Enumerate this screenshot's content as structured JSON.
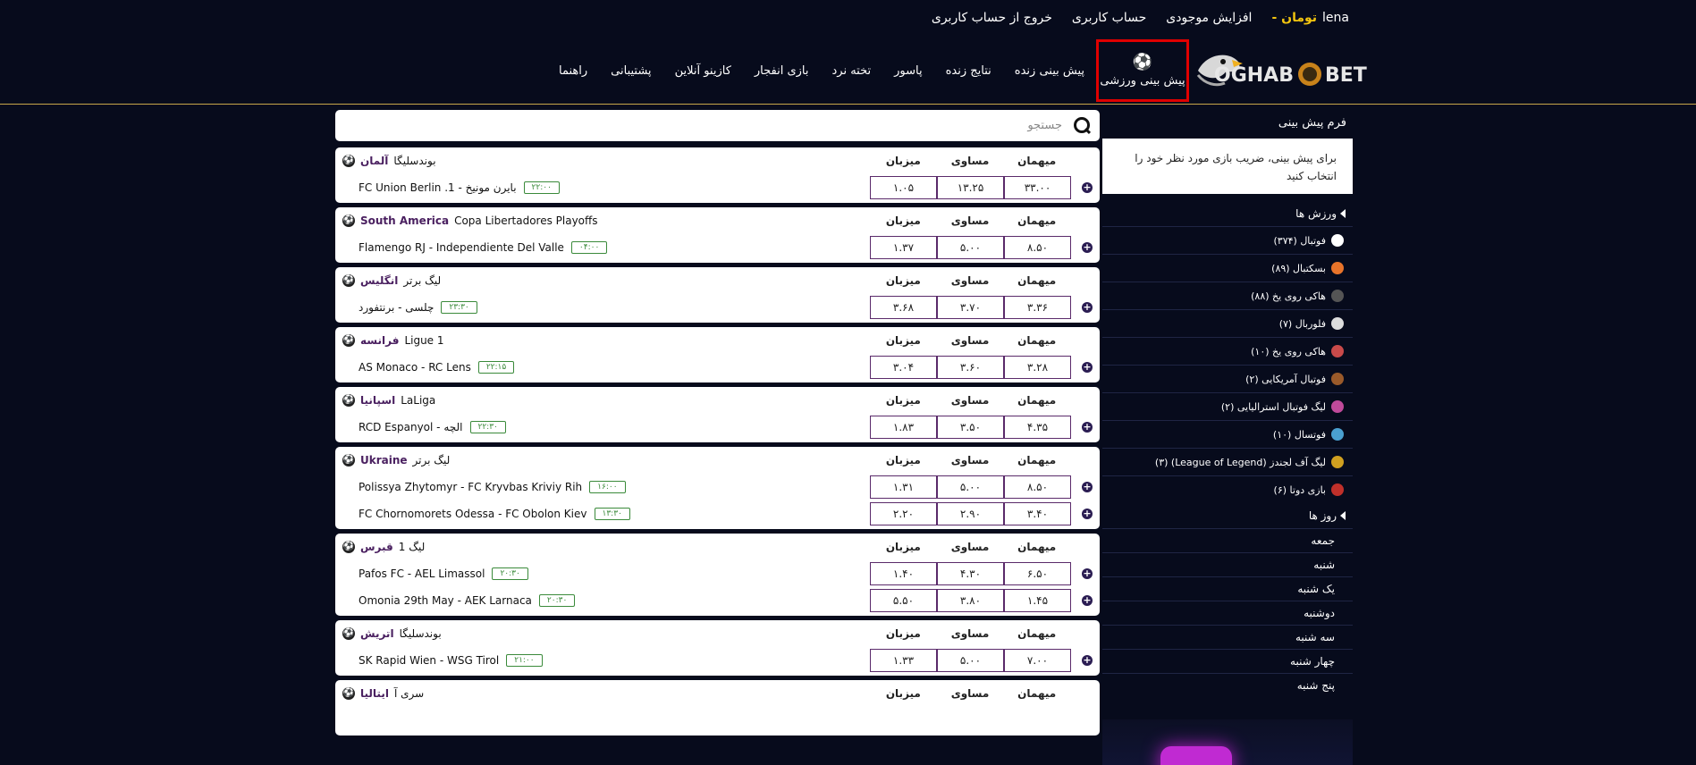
{
  "topbar": {
    "username": "lena",
    "currency": "تومان -",
    "deposit": "افزایش موجودی",
    "account": "حساب کاربری",
    "logout": "خروج از حساب کاربری"
  },
  "logo": {
    "text_left": "OGHAB",
    "text_right": "BET"
  },
  "nav": {
    "items": [
      "پیش بینی ورزشی",
      "پیش بینی زنده",
      "نتایج زنده",
      "پاسور",
      "تخته نرد",
      "بازی انفجار",
      "کازینو آنلاین",
      "پشتیبانی",
      "راهنما"
    ]
  },
  "search": {
    "placeholder": "جستجو"
  },
  "columns": {
    "away": "میهمان",
    "draw": "مساوی",
    "home": "میزبان"
  },
  "matches": [
    {
      "country": "آلمان",
      "league": "بوندسلیگا",
      "rows": [
        {
          "teams": "FC Union Berlin .1 - بایرن مونیخ",
          "time": "۲۲:۰۰",
          "away": "۳۳.۰۰",
          "draw": "۱۳.۲۵",
          "home": "۱.۰۵"
        }
      ]
    },
    {
      "country": "South America",
      "league": "Copa Libertadores Playoffs",
      "rows": [
        {
          "teams": "Flamengo RJ - Independiente Del Valle",
          "time": "۰۴:۰۰",
          "away": "۸.۵۰",
          "draw": "۵.۰۰",
          "home": "۱.۳۷"
        }
      ]
    },
    {
      "country": "انگلیس",
      "league": "لیگ برتر",
      "rows": [
        {
          "teams": "چلسی - برنتفورد",
          "time": "۲۳:۳۰",
          "away": "۳.۳۶",
          "draw": "۳.۷۰",
          "home": "۳.۶۸"
        }
      ]
    },
    {
      "country": "فرانسه",
      "league": "Ligue 1",
      "rows": [
        {
          "teams": "AS Monaco - RC Lens",
          "time": "۲۲:۱۵",
          "away": "۳.۲۸",
          "draw": "۳.۶۰",
          "home": "۳.۰۴"
        }
      ]
    },
    {
      "country": "اسپانیا",
      "league": "LaLiga",
      "rows": [
        {
          "teams": "RCD Espanyol - الچه",
          "time": "۲۲:۳۰",
          "away": "۴.۳۵",
          "draw": "۳.۵۰",
          "home": "۱.۸۳"
        }
      ]
    },
    {
      "country": "Ukraine",
      "league": "لیگ برتر",
      "rows": [
        {
          "teams": "Polissya Zhytomyr - FC Kryvbas Kriviy Rih",
          "time": "۱۶:۰۰",
          "away": "۸.۵۰",
          "draw": "۵.۰۰",
          "home": "۱.۳۱"
        },
        {
          "teams": "FC Chornomorets Odessa - FC Obolon Kiev",
          "time": "۱۳:۳۰",
          "away": "۳.۴۰",
          "draw": "۲.۹۰",
          "home": "۲.۲۰"
        }
      ]
    },
    {
      "country": "قبرس",
      "league": "لیگ 1",
      "rows": [
        {
          "teams": "Pafos FC - AEL Limassol",
          "time": "۲۰:۳۰",
          "away": "۶.۵۰",
          "draw": "۴.۳۰",
          "home": "۱.۴۰"
        },
        {
          "teams": "Omonia 29th May - AEK Larnaca",
          "time": "۲۰:۳۰",
          "away": "۱.۴۵",
          "draw": "۳.۸۰",
          "home": "۵.۵۰"
        }
      ]
    },
    {
      "country": "اتریش",
      "league": "بوندسلیگا",
      "rows": [
        {
          "teams": "SK Rapid Wien - WSG Tirol",
          "time": "۲۱:۰۰",
          "away": "۷.۰۰",
          "draw": "۵.۰۰",
          "home": "۱.۳۳"
        }
      ]
    },
    {
      "country": "ایتالیا",
      "league": "سری آ",
      "rows": []
    }
  ],
  "sidebar": {
    "slip_title": "فرم پیش بینی",
    "slip_text": "برای پیش بینی، ضریب بازی مورد نظر خود را انتخاب کنید",
    "sports_title": "ورزش ها",
    "sports": [
      {
        "label": "فوتبال (۳۷۴)",
        "color": "#ffffff"
      },
      {
        "label": "بسکتبال (۸۹)",
        "color": "#e8742a"
      },
      {
        "label": "هاکی روی یخ (۸۸)",
        "color": "#555555"
      },
      {
        "label": "فلوربال (۷)",
        "color": "#dddddd"
      },
      {
        "label": "هاکی روی یخ (۱۰)",
        "color": "#c94a4a"
      },
      {
        "label": "فوتبال آمریکایی (۲)",
        "color": "#9a5a2a"
      },
      {
        "label": "لیگ فوتبال استرالیایی (۲)",
        "color": "#c04a9a"
      },
      {
        "label": "فوتسال (۱۰)",
        "color": "#4aa0d0"
      },
      {
        "label": "لیگ آف لجندز (League of Legend) (۳)",
        "color": "#d0a020"
      },
      {
        "label": "بازی دوتا (۶)",
        "color": "#c0302a"
      }
    ],
    "days_title": "روز ها",
    "days": [
      "جمعه",
      "شنبه",
      "یک شنبه",
      "دوشنبه",
      "سه شنبه",
      "چهار شنبه",
      "پنج شنبه"
    ]
  }
}
